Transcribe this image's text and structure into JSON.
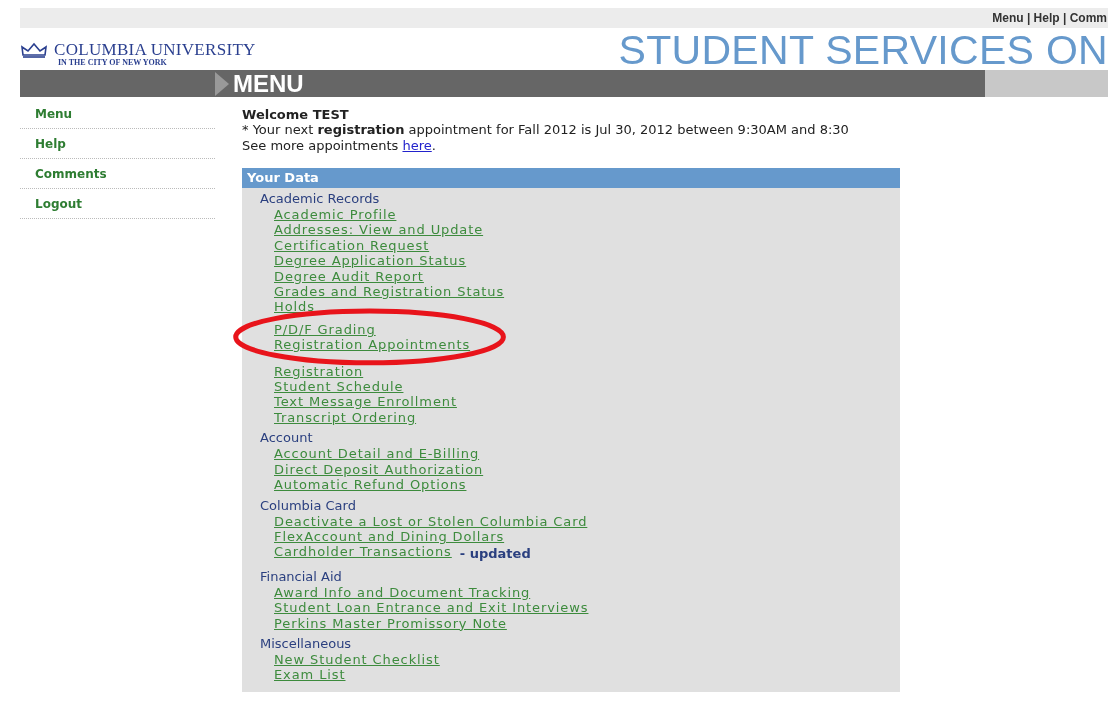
{
  "top_links": "Menu | Help | Comm",
  "header": {
    "logo_title": "COLUMBIA UNIVERSITY",
    "logo_subtitle": "IN THE CITY OF NEW YORK",
    "banner_title": "STUDENT SERVICES ON",
    "menu_bar_title": "MENU"
  },
  "sidebar": {
    "items": [
      {
        "label": "Menu"
      },
      {
        "label": "Help"
      },
      {
        "label": "Comments"
      },
      {
        "label": "Logout"
      }
    ]
  },
  "welcome": {
    "heading": "Welcome TEST",
    "notice": "* Your next **registration** appointment for Fall 2012 is Jul 30, 2012 between 9:30AM and 8:30",
    "more_text": "See more appointments",
    "more_link": "here",
    "more_end": "."
  },
  "data_panel": {
    "title": "Your Data",
    "sections": [
      {
        "title": "Academic Records",
        "links": [
          {
            "kind": "link",
            "label": "Academic Profile"
          },
          {
            "kind": "link",
            "label": "Addresses: View and Update"
          },
          {
            "kind": "link",
            "label": "Certification Request"
          },
          {
            "kind": "link",
            "label": "Degree Application Status"
          },
          {
            "kind": "link",
            "label": "Degree Audit Report"
          },
          {
            "kind": "link",
            "label": "Grades and Registration Status"
          },
          {
            "kind": "link",
            "label": "Holds"
          },
          {
            "kind": "circled_group",
            "links": [
              {
                "label": "P/D/F Grading"
              },
              {
                "label": "Registration Appointments"
              }
            ]
          },
          {
            "kind": "link",
            "label": "Registration"
          },
          {
            "kind": "link",
            "label": "Student Schedule"
          },
          {
            "kind": "link",
            "label": "Text Message Enrollment"
          },
          {
            "kind": "link",
            "label": "Transcript Ordering"
          }
        ]
      },
      {
        "title": "Account",
        "links": [
          {
            "kind": "link",
            "label": "Account Detail and E-Billing"
          },
          {
            "kind": "link",
            "label": "Direct Deposit Authorization"
          },
          {
            "kind": "link",
            "label": "Automatic Refund Options"
          }
        ]
      },
      {
        "title": "Columbia Card",
        "links": [
          {
            "kind": "link",
            "label": "Deactivate a Lost or Stolen Columbia Card"
          },
          {
            "kind": "link",
            "label": "FlexAccount and Dining Dollars"
          },
          {
            "kind": "link",
            "label": "Cardholder Transactions",
            "note": "- updated"
          }
        ]
      },
      {
        "title": "Financial Aid",
        "links": [
          {
            "kind": "link",
            "label": "Award Info and Document Tracking"
          },
          {
            "kind": "link",
            "label": "Student Loan Entrance and Exit Interviews"
          },
          {
            "kind": "link",
            "label": "Perkins Master Promissory Note"
          }
        ]
      },
      {
        "title": "Miscellaneous",
        "links": [
          {
            "kind": "link",
            "label": "New Student Checklist"
          },
          {
            "kind": "link",
            "label": "Exam List"
          }
        ]
      }
    ]
  }
}
